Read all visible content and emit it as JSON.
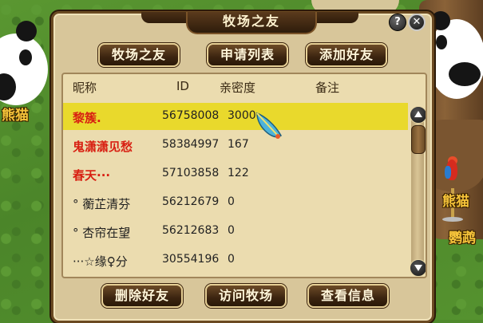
{
  "world": {
    "npc_left_label": "熊猫",
    "npc_right_label_1": "熊猫",
    "npc_right_label_2": "鹦鹉"
  },
  "dialog": {
    "title": "牧场之友",
    "help": "?",
    "close": "✕",
    "tabs": [
      "牧场之友",
      "申请列表",
      "添加好友"
    ],
    "columns": {
      "nick": "昵称",
      "id": "ID",
      "closeness": "亲密度",
      "note": "备注"
    },
    "rows": [
      {
        "nick": "黎簇.",
        "id": "56758008",
        "closeness": "3000",
        "note": "",
        "style": "red",
        "selected": true
      },
      {
        "nick": "鬼潇潇见愁",
        "id": "58384997",
        "closeness": "167",
        "note": "",
        "style": "red",
        "selected": false
      },
      {
        "nick": "春天···",
        "id": "57103858",
        "closeness": "122",
        "note": "",
        "style": "red",
        "selected": false
      },
      {
        "nick": "° 蘅芷清芬",
        "id": "56212679",
        "closeness": "0",
        "note": "",
        "style": "dark",
        "selected": false
      },
      {
        "nick": "° 杏帘在望",
        "id": "56212683",
        "closeness": "0",
        "note": "",
        "style": "dark",
        "selected": false
      },
      {
        "nick": "···☆缘♀分",
        "id": "30554196",
        "closeness": "0",
        "note": "",
        "style": "dark",
        "selected": false
      }
    ],
    "actions": [
      "删除好友",
      "访问牧场",
      "查看信息"
    ],
    "colors": {
      "selected_row": "#e9d92c",
      "red_name": "#d81f12",
      "button_text": "#fff6da"
    }
  }
}
